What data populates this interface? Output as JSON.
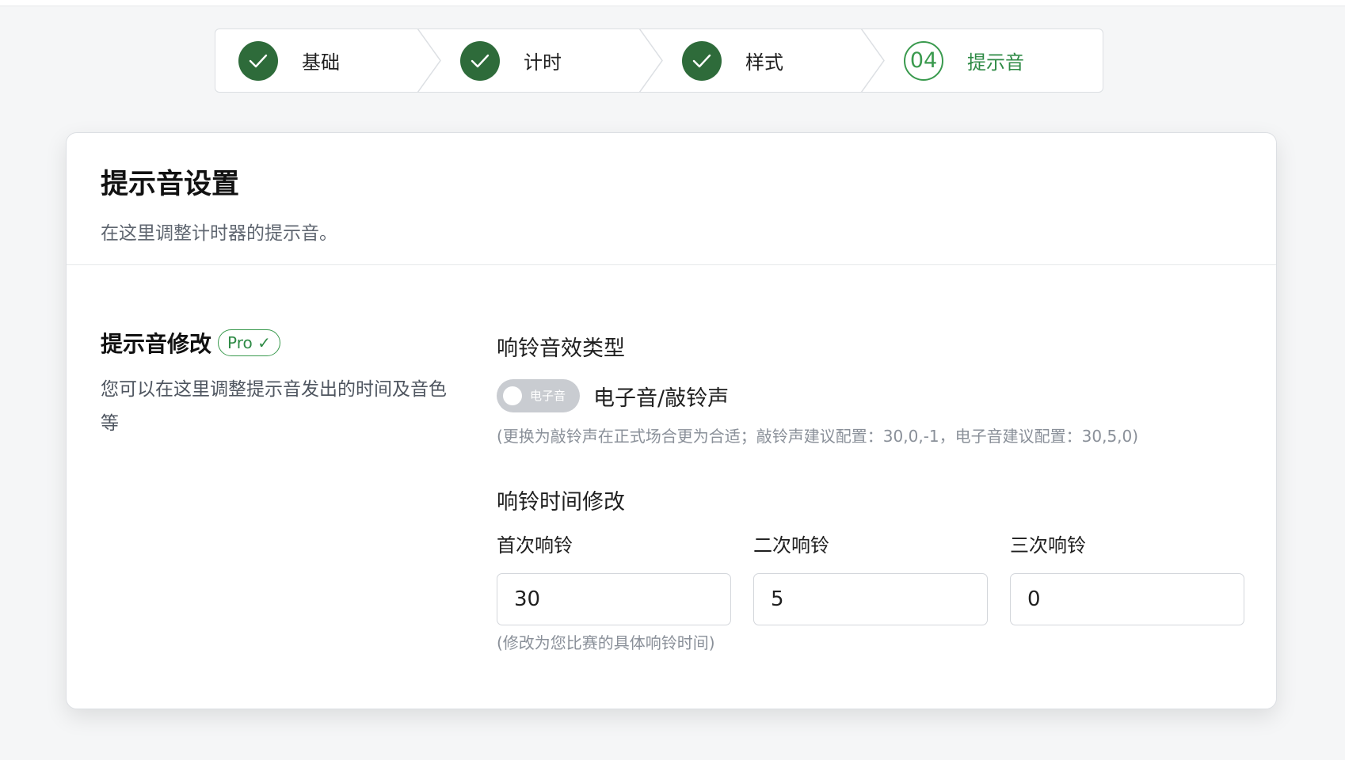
{
  "steps": [
    {
      "label": "基础",
      "state": "done",
      "icon": "check-icon"
    },
    {
      "label": "计时",
      "state": "done",
      "icon": "check-icon"
    },
    {
      "label": "样式",
      "state": "done",
      "icon": "check-icon"
    },
    {
      "label": "提示音",
      "state": "active",
      "number": "04"
    }
  ],
  "card": {
    "title": "提示音设置",
    "description": "在这里调整计时器的提示音。"
  },
  "section": {
    "title": "提示音修改",
    "badge": "Pro ✓",
    "description": "您可以在这里调整提示音发出的时间及音色等"
  },
  "ring_type": {
    "title": "响铃音效类型",
    "switch_text": "电子音",
    "switch_on": false,
    "label": "电子音/敲铃声",
    "hint": "(更换为敲铃声在正式场合更为合适；敲铃声建议配置：30,0,-1，电子音建议配置：30,5,0)"
  },
  "ring_time": {
    "title": "响铃时间修改",
    "fields": [
      {
        "label": "首次响铃",
        "value": "30"
      },
      {
        "label": "二次响铃",
        "value": "5"
      },
      {
        "label": "三次响铃",
        "value": "0"
      }
    ],
    "hint": "(修改为您比赛的具体响铃时间)"
  },
  "colors": {
    "accent": "#2e8a45",
    "done_circle": "#2e6b3a",
    "switch_off": "#c9ccd1"
  }
}
